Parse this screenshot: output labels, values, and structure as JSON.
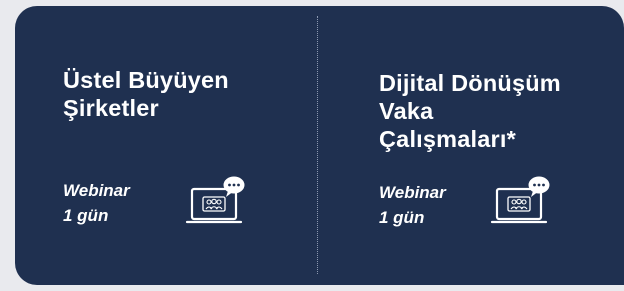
{
  "courses": [
    {
      "title_lines": [
        "Üstel Büyüyen",
        "Şirketler"
      ],
      "format": "Webinar",
      "duration": "1 gün",
      "icon": "webinar-icon"
    },
    {
      "title_lines": [
        "Dijital Dönüşüm",
        "Vaka",
        "Çalışmaları*"
      ],
      "format": "Webinar",
      "duration": "1 gün",
      "icon": "webinar-icon"
    }
  ],
  "colors": {
    "card_background": "#1f3050",
    "page_background": "#e9eaee",
    "text": "#ffffff",
    "icon_stroke": "#ffffff"
  }
}
